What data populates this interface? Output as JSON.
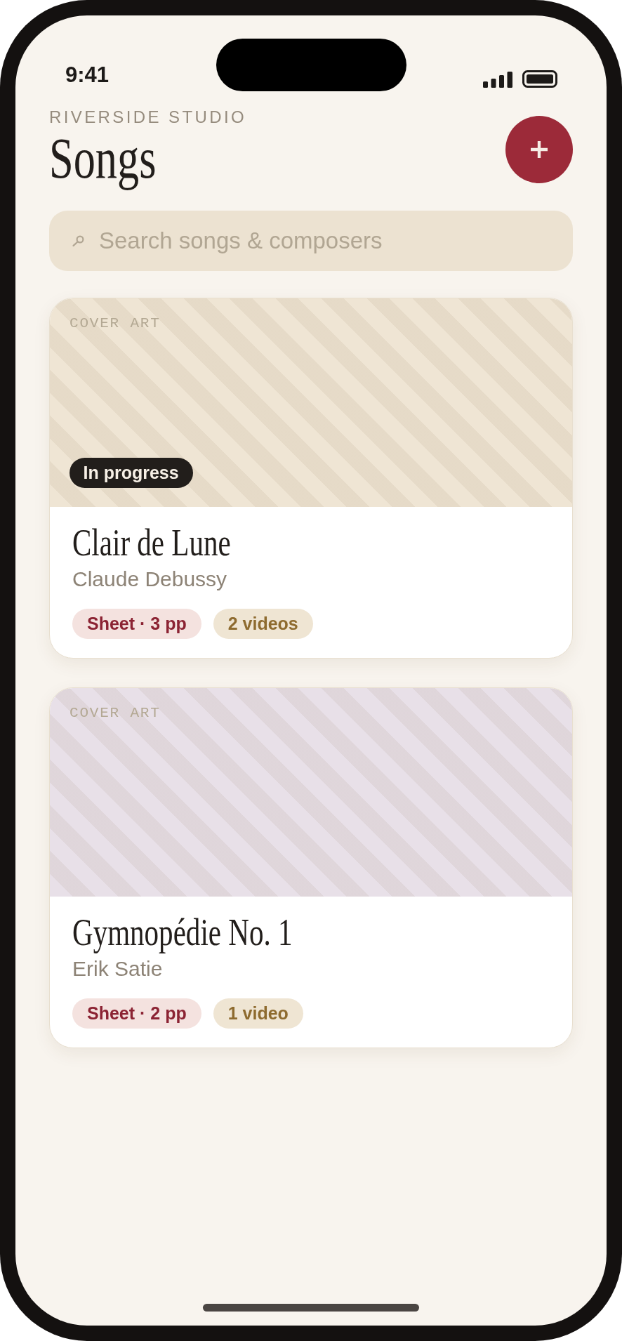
{
  "status_bar": {
    "time": "9:41"
  },
  "header": {
    "eyebrow": "RIVERSIDE STUDIO",
    "title": "Songs"
  },
  "search": {
    "placeholder": "Search songs & composers"
  },
  "songs": [
    {
      "cover_label": "COVER ART",
      "color": "#efe5d4",
      "status": "In progress",
      "title": "Clair de Lune",
      "composer": "Claude Debussy",
      "tags": [
        {
          "kind": "sheet",
          "label": "Sheet · 3 pp"
        },
        {
          "kind": "video",
          "label": "2 videos"
        }
      ]
    },
    {
      "cover_label": "COVER ART",
      "color": "#e8e0e8",
      "title": "Gymnopédie No. 1",
      "composer": "Erik Satie",
      "tags": [
        {
          "kind": "sheet",
          "label": "Sheet · 2 pp"
        },
        {
          "kind": "video",
          "label": "1 video"
        }
      ]
    }
  ]
}
